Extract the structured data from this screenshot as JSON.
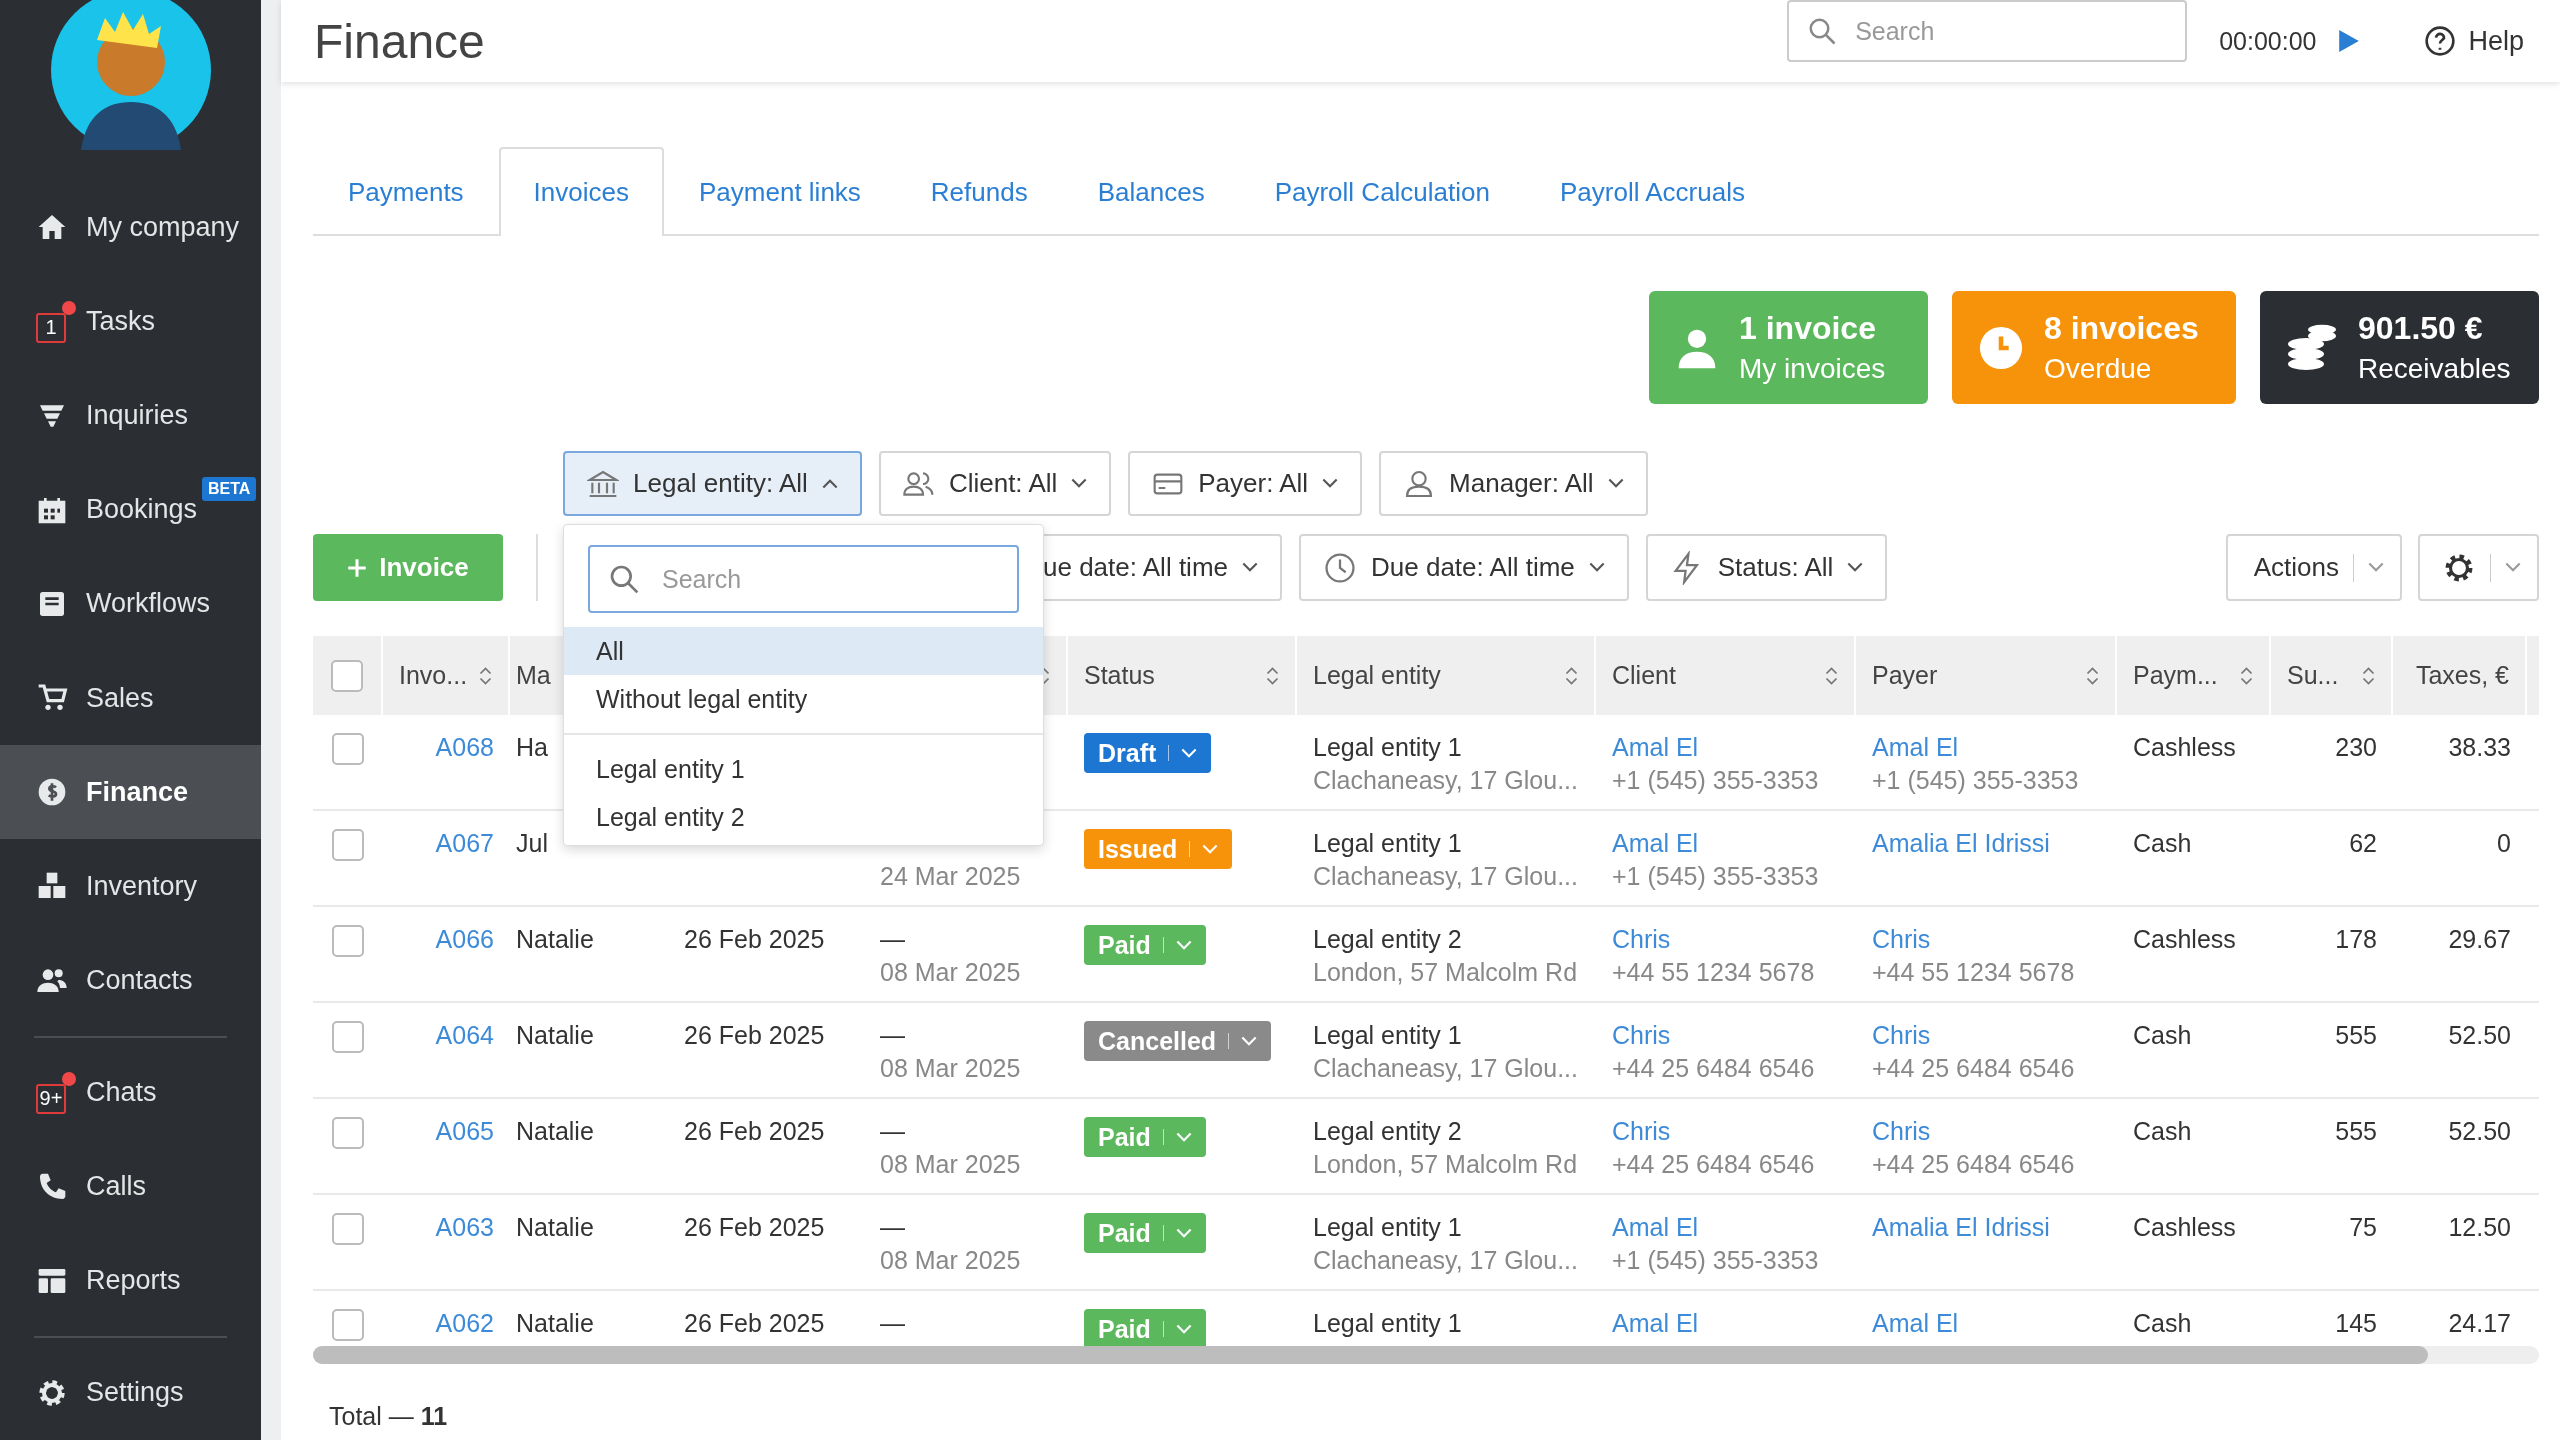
{
  "sidebar": {
    "groups": [
      [
        {
          "label": "My company",
          "selected": false
        },
        {
          "label": "Tasks",
          "selected": false,
          "badge": "1"
        },
        {
          "label": "Inquiries",
          "selected": false
        },
        {
          "label": "Bookings",
          "selected": false,
          "tag": "BETA"
        },
        {
          "label": "Workflows",
          "selected": false
        },
        {
          "label": "Sales",
          "selected": false
        },
        {
          "label": "Finance",
          "selected": true
        },
        {
          "label": "Inventory",
          "selected": false
        },
        {
          "label": "Contacts",
          "selected": false
        }
      ],
      [
        {
          "label": "Chats",
          "selected": false,
          "badge": "9+"
        },
        {
          "label": "Calls",
          "selected": false
        },
        {
          "label": "Reports",
          "selected": false
        }
      ],
      [
        {
          "label": "Settings",
          "selected": false
        }
      ]
    ]
  },
  "header": {
    "title": "Finance",
    "search": {
      "placeholder": "Search"
    },
    "timer": "00:00:00",
    "help": "Help"
  },
  "tabs": [
    {
      "label": "Payments",
      "selected": false
    },
    {
      "label": "Invoices",
      "selected": true
    },
    {
      "label": "Payment links",
      "selected": false
    },
    {
      "label": "Refunds",
      "selected": false
    },
    {
      "label": "Balances",
      "selected": false
    },
    {
      "label": "Payroll Calculation",
      "selected": false
    },
    {
      "label": "Payroll Accruals",
      "selected": false
    }
  ],
  "stat_cards": [
    {
      "kind": "mine",
      "value": "1 invoice",
      "label": "My invoices"
    },
    {
      "kind": "overdue",
      "value": "8 invoices",
      "label": "Overdue"
    },
    {
      "kind": "receivables",
      "value": "901.50 €",
      "label": "Receivables"
    }
  ],
  "filters": [
    {
      "kind": "entity",
      "label": "Legal entity: All",
      "open": true
    },
    {
      "kind": "client",
      "label": "Client: All",
      "open": false
    },
    {
      "kind": "payer",
      "label": "Payer: All",
      "open": false
    },
    {
      "kind": "manager",
      "label": "Manager: All",
      "open": false
    }
  ],
  "dropdown": {
    "search": {
      "placeholder": "Search"
    },
    "groups": [
      [
        {
          "label": "All",
          "selected": true
        },
        {
          "label": "Without legal entity",
          "selected": false
        }
      ],
      [
        {
          "label": "Legal entity 1",
          "selected": false
        },
        {
          "label": "Legal entity 2",
          "selected": false
        }
      ]
    ]
  },
  "toolbar": {
    "new_button": "Invoice",
    "filters": [
      {
        "kind": "none",
        "label": "ue date: All time"
      },
      {
        "kind": "clock",
        "label": "Due date: All time"
      },
      {
        "kind": "status",
        "label": "Status: All"
      }
    ],
    "actions": "Actions"
  },
  "table": {
    "all_checked": false,
    "columns": [
      {
        "label": "Invo...",
        "sortable": true
      },
      {
        "label": "Ma",
        "sortable": false
      },
      {},
      {
        "sortable": true
      },
      {
        "label": "Status",
        "sortable": true
      },
      {
        "label": "Legal entity",
        "sortable": true
      },
      {
        "label": "Client",
        "sortable": true
      },
      {
        "label": "Payer",
        "sortable": true
      },
      {
        "label": "Paym...",
        "sortable": true
      },
      {
        "label": "Su...",
        "sortable": true
      },
      {
        "label": "Taxes, €",
        "sortable": false
      }
    ],
    "rows": [
      {
        "checked": false,
        "invoice": "A068",
        "manager": "Ha",
        "status": {
          "kind": "draft",
          "label": "Draft"
        },
        "entity": {
          "name": "Legal entity 1",
          "address": "Clachaneasy, 17 Glou..."
        },
        "client": {
          "name": "Amal El",
          "phone": "+1 (545) 355-3353"
        },
        "payer": {
          "name": "Amal El",
          "phone": "+1 (545) 355-3353"
        },
        "payment": "Cashless",
        "sum": "230",
        "taxes": "38.33"
      },
      {
        "checked": false,
        "invoice": "A067",
        "manager": "Jul",
        "due": {
          "date": "24 Mar 2025"
        },
        "status": {
          "kind": "issued",
          "label": "Issued"
        },
        "entity": {
          "name": "Legal entity 1",
          "address": "Clachaneasy, 17 Glou..."
        },
        "client": {
          "name": "Amal El",
          "phone": "+1 (545) 355-3353"
        },
        "payer": {
          "name": "Amalia El Idrissi"
        },
        "payment": "Cash",
        "sum": "62",
        "taxes": "0"
      },
      {
        "checked": false,
        "invoice": "A066",
        "manager": "Natalie",
        "created": "26 Feb 2025",
        "due": {
          "dash": "—",
          "date": "08 Mar 2025"
        },
        "status": {
          "kind": "paid",
          "label": "Paid"
        },
        "entity": {
          "name": "Legal entity 2",
          "address": "London, 57 Malcolm Rd"
        },
        "client": {
          "name": "Chris",
          "phone": "+44 55 1234 5678"
        },
        "payer": {
          "name": "Chris",
          "phone": "+44 55 1234 5678"
        },
        "payment": "Cashless",
        "sum": "178",
        "taxes": "29.67"
      },
      {
        "checked": false,
        "invoice": "A064",
        "manager": "Natalie",
        "created": "26 Feb 2025",
        "due": {
          "dash": "—",
          "date": "08 Mar 2025"
        },
        "status": {
          "kind": "cancelled",
          "label": "Cancelled"
        },
        "entity": {
          "name": "Legal entity 1",
          "address": "Clachaneasy, 17 Glou..."
        },
        "client": {
          "name": "Chris",
          "phone": "+44 25 6484 6546"
        },
        "payer": {
          "name": "Chris",
          "phone": "+44 25 6484 6546"
        },
        "payment": "Cash",
        "sum": "555",
        "taxes": "52.50"
      },
      {
        "checked": false,
        "invoice": "A065",
        "manager": "Natalie",
        "created": "26 Feb 2025",
        "due": {
          "dash": "—",
          "date": "08 Mar 2025"
        },
        "status": {
          "kind": "paid",
          "label": "Paid"
        },
        "entity": {
          "name": "Legal entity 2",
          "address": "London, 57 Malcolm Rd"
        },
        "client": {
          "name": "Chris",
          "phone": "+44 25 6484 6546"
        },
        "payer": {
          "name": "Chris",
          "phone": "+44 25 6484 6546"
        },
        "payment": "Cash",
        "sum": "555",
        "taxes": "52.50"
      },
      {
        "checked": false,
        "invoice": "A063",
        "manager": "Natalie",
        "created": "26 Feb 2025",
        "due": {
          "dash": "—",
          "date": "08 Mar 2025"
        },
        "status": {
          "kind": "paid",
          "label": "Paid"
        },
        "entity": {
          "name": "Legal entity 1",
          "address": "Clachaneasy, 17 Glou..."
        },
        "client": {
          "name": "Amal El",
          "phone": "+1 (545) 355-3353"
        },
        "payer": {
          "name": "Amalia El Idrissi"
        },
        "payment": "Cashless",
        "sum": "75",
        "taxes": "12.50"
      },
      {
        "checked": false,
        "invoice": "A062",
        "manager": "Natalie",
        "created": "26 Feb 2025",
        "due": {
          "dash": "—"
        },
        "status": {
          "kind": "paid",
          "label": "Paid"
        },
        "entity": {
          "name": "Legal entity 1"
        },
        "client": {
          "name": "Amal El"
        },
        "payer": {
          "name": "Amal El"
        },
        "payment": "Cash",
        "sum": "145",
        "taxes": "24.17"
      }
    ]
  },
  "total": "Total — **11**"
}
